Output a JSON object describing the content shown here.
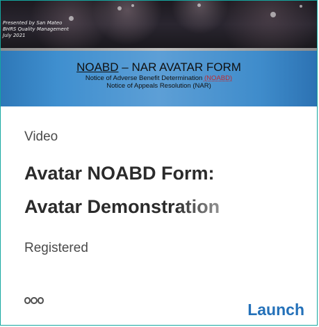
{
  "thumbnail": {
    "presented_lines": [
      "Presented by San Mateo",
      "BHRS Quality Management",
      "July 2021"
    ],
    "banner_title_part1": "NOABD",
    "banner_title_part2": " – NAR AVATAR FORM",
    "banner_sub1_text": "Notice of Adverse Benefit Determination ",
    "banner_sub1_acronym": "(NOABD)",
    "banner_sub2": "Notice of Appeals Resolution (NAR)"
  },
  "card": {
    "type_label": "Video",
    "title_line1": "Avatar NOABD Form:",
    "title_line2": "Avatar Demonstration",
    "status": "Registered",
    "more_icon": "ellipsis-icon",
    "launch_label": "Launch",
    "accent_color": "#14a7a0",
    "link_color": "#2471b9"
  }
}
